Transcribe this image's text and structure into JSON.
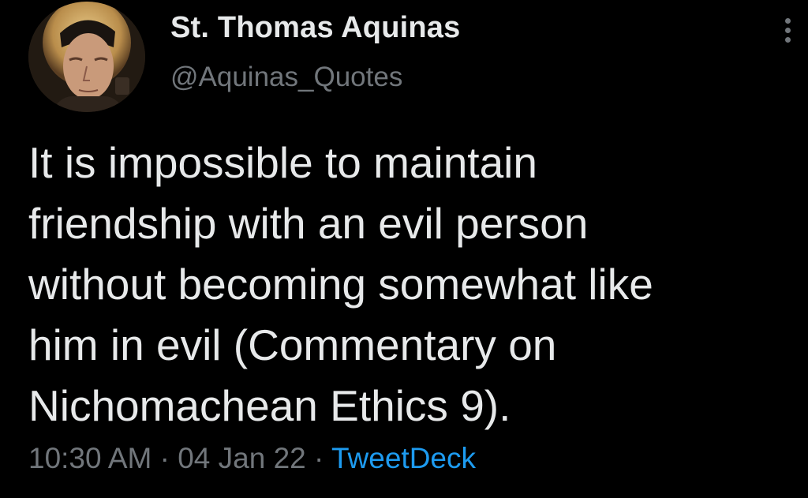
{
  "tweet": {
    "author_name": "St. Thomas Aquinas",
    "author_handle": "@Aquinas_Quotes",
    "text": "It is impossible to maintain\nfriendship with an evil person\nwithout becoming somewhat like\nhim in evil (Commentary on\nNichomachean Ethics 9).",
    "time": "10:30 AM",
    "separator": "·",
    "date": "04 Jan 22",
    "source": "TweetDeck"
  },
  "icons": {
    "more_menu": "more-horizontal-icon"
  },
  "colors": {
    "background": "#000000",
    "primary_text": "#e7e9ea",
    "secondary_text": "#71767b",
    "link": "#1d9bf0"
  }
}
